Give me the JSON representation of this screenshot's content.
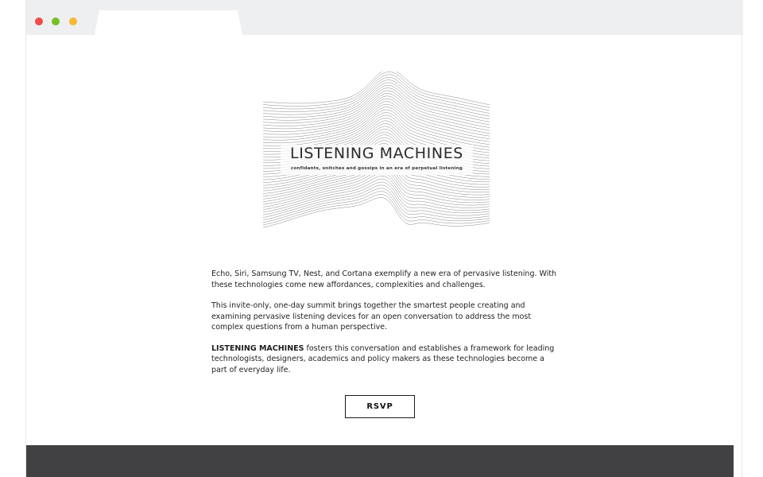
{
  "window": {
    "controls": [
      "close",
      "minimize",
      "maximize"
    ]
  },
  "hero": {
    "title": "LISTENING MACHINES",
    "subtitle": "confidants, snitches and gossips in an era of perpetual listening"
  },
  "content": {
    "p1": "Echo, Siri, Samsung TV, Nest, and Cortana exemplify a new era of pervasive listening. With these technologies come new affordances, complexities and challenges.",
    "p2": "This invite-only, one-day summit brings together the smartest people creating and examining pervasive listening devices for an open conversation to address the most complex questions from a human perspective.",
    "p3_strong": "LISTENING MACHINES",
    "p3_rest": " fosters this conversation and establishes a framework for leading technologists, designers, academics and policy makers as these technologies become a part of everyday life."
  },
  "rsvp": {
    "label": "RSVP"
  },
  "colors": {
    "chrome": "#edeff0",
    "footer": "#414143",
    "close": "#f04b4b",
    "minimize": "#78bf27",
    "maximize": "#f7b933"
  }
}
